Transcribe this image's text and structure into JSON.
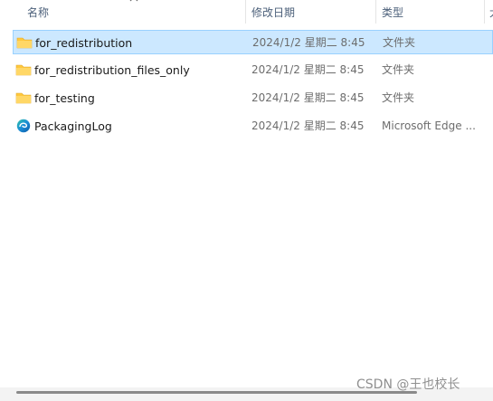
{
  "columns": {
    "name": "名称",
    "date_modified": "修改日期",
    "type": "类型",
    "size_partial": "大"
  },
  "files": [
    {
      "name": "for_redistribution",
      "date": "2024/1/2 星期二 8:45",
      "type": "文件夹",
      "icon": "folder-icon",
      "selected": true
    },
    {
      "name": "for_redistribution_files_only",
      "date": "2024/1/2 星期二 8:45",
      "type": "文件夹",
      "icon": "folder-icon",
      "selected": false
    },
    {
      "name": "for_testing",
      "date": "2024/1/2 星期二 8:45",
      "type": "文件夹",
      "icon": "folder-icon",
      "selected": false
    },
    {
      "name": "PackagingLog",
      "date": "2024/1/2 星期二 8:45",
      "type": "Microsoft Edge ...",
      "icon": "edge-icon",
      "selected": false
    }
  ],
  "watermark": "CSDN @王也校长",
  "colors": {
    "selection_bg": "#cce8ff",
    "selection_border": "#99d1ff",
    "folder": "#ffc83d",
    "header_text": "#4c607a"
  }
}
